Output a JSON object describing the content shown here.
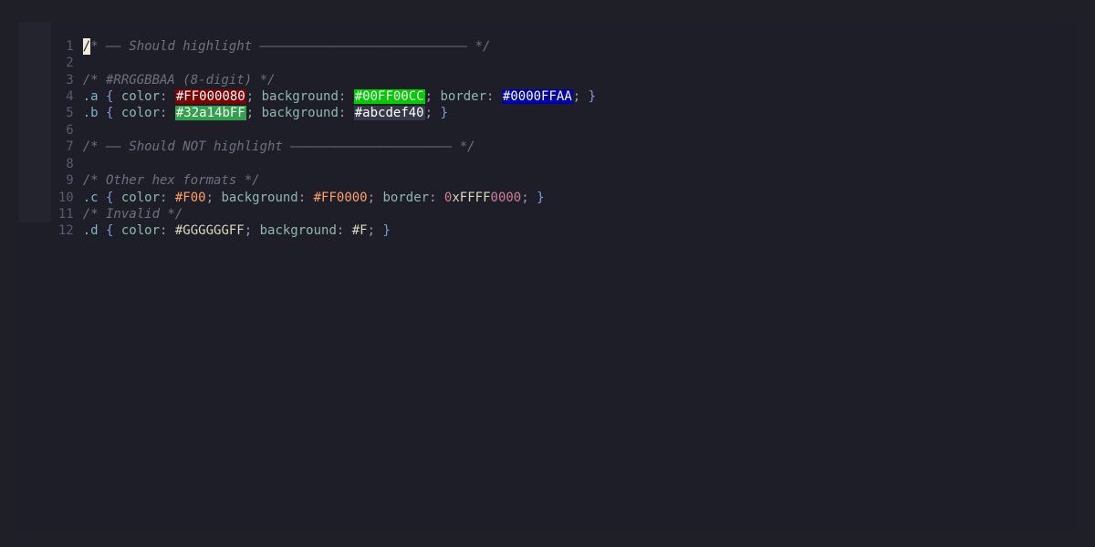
{
  "editor": {
    "line_numbers": [
      "1",
      "2",
      "3",
      "4",
      "5",
      "6",
      "7",
      "8",
      "9",
      "10",
      "11",
      "12"
    ],
    "line1": {
      "cursor_char": "/",
      "comment": "* —— Should highlight ——————————————————————————— */"
    },
    "line3": {
      "comment": "/* #RRGGBBAA (8-digit) */"
    },
    "line4": {
      "selector": ".a",
      "open": " {",
      "p1": " color",
      "c1": ": ",
      "v1": "#FF000080",
      "s1": "; ",
      "p2": "background",
      "c2": ": ",
      "v2": "#00FF00CC",
      "s2": "; ",
      "p3": "border",
      "c3": ": ",
      "v3": "#0000FFAA",
      "s3": "; ",
      "close": "}",
      "swatches": {
        "v1": {
          "bg": "#7f0000",
          "fg": "#ffffff"
        },
        "v2": {
          "bg": "#00cc00",
          "fg": "#ffffff"
        },
        "v3": {
          "bg": "#0000aa",
          "fg": "#ffffff"
        }
      }
    },
    "line5": {
      "selector": ".b",
      "open": " {",
      "p1": " color",
      "c1": ": ",
      "v1": "#32a14bFF",
      "s1": "; ",
      "p2": "background",
      "c2": ": ",
      "v2": "#abcdef40",
      "s2": "; ",
      "close": "}",
      "swatches": {
        "v1": {
          "bg": "#32a14b",
          "fg": "#ffffff"
        },
        "v2": {
          "bg": "#34394a",
          "fg": "#ffffff"
        }
      }
    },
    "line7": {
      "comment": "/* —— Should NOT highlight ————————————————————— */"
    },
    "line9": {
      "comment": "/* Other hex formats */"
    },
    "line10": {
      "selector": ".c",
      "open": " {",
      "p1": " color",
      "c1": ": ",
      "v1": "#F00",
      "s1": "; ",
      "p2": "background",
      "c2": ": ",
      "v2": "#FF0000",
      "s2": "; ",
      "p3": "border",
      "c3": ": ",
      "v3a": "0",
      "v3b": "xFFFF",
      "v3c": "0000",
      "s3": "; ",
      "close": "}"
    },
    "line11": {
      "comment": "/* Invalid */"
    },
    "line12": {
      "selector": ".d",
      "open": " {",
      "p1": " color",
      "c1": ": ",
      "v1": "#GGGGGGFF",
      "s1": "; ",
      "p2": "background",
      "c2": ": ",
      "v2": "#F",
      "s2": "; ",
      "close": "}"
    }
  }
}
